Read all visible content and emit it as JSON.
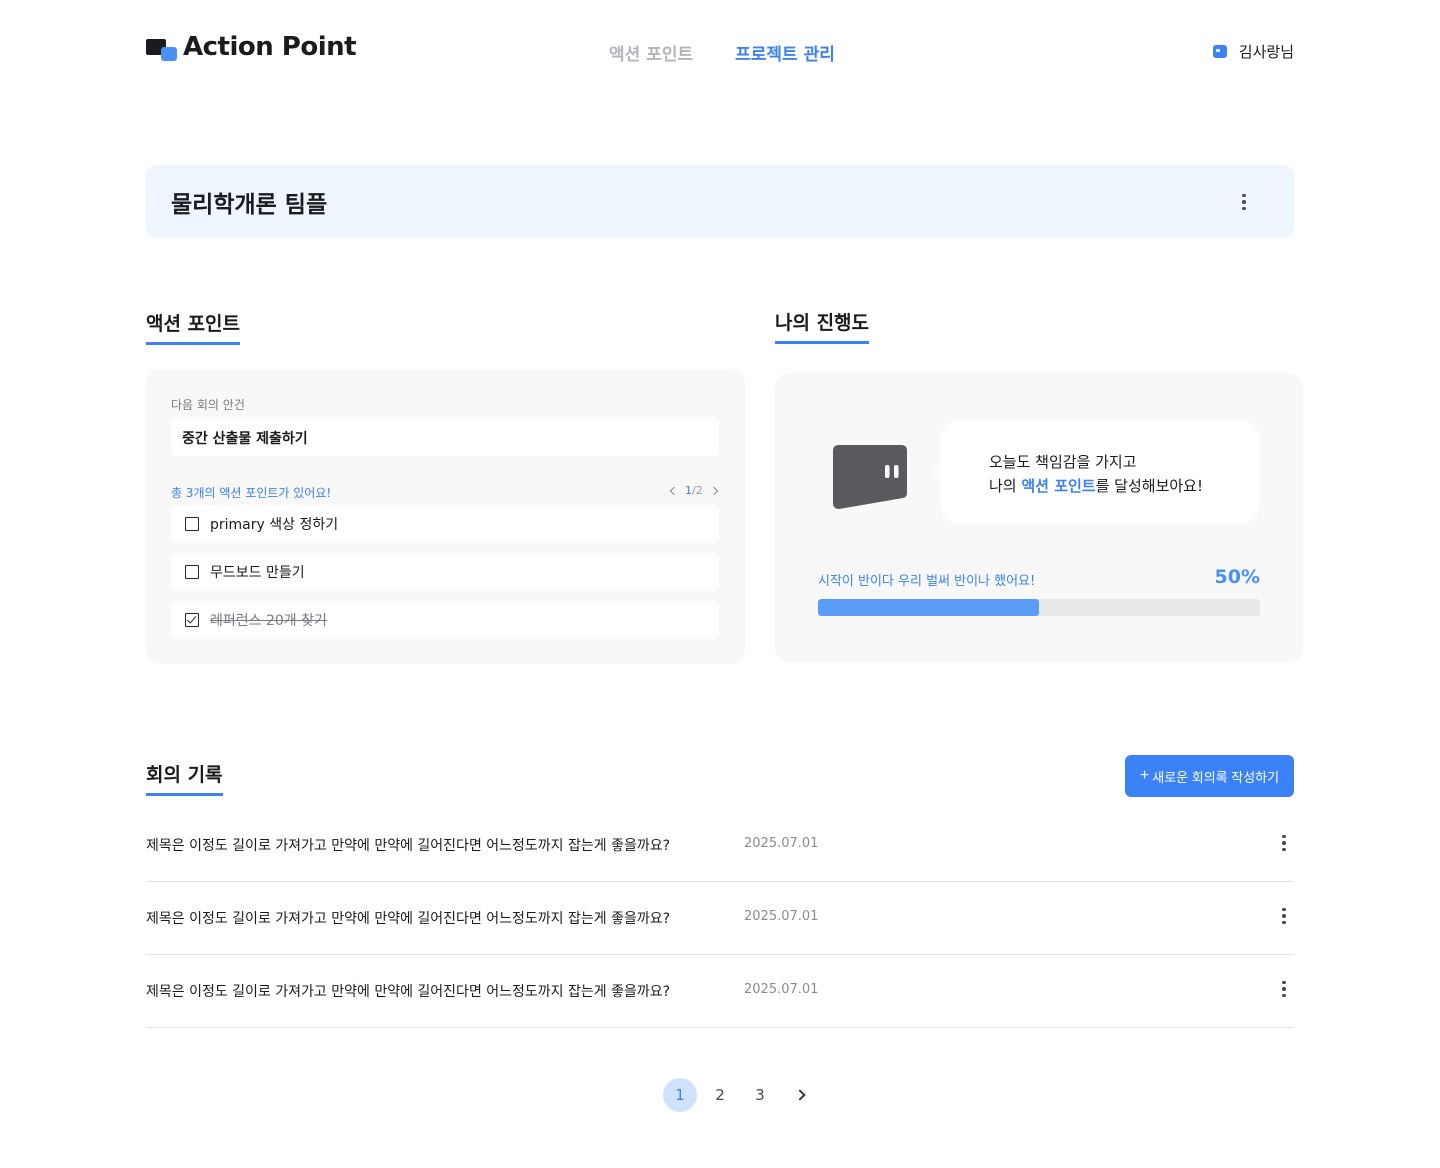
{
  "header": {
    "logo_text": "Action Point",
    "nav": [
      {
        "label": "액션 포인트",
        "active": false
      },
      {
        "label": "프로젝트 관리",
        "active": true
      }
    ],
    "user_name": "김사랑님"
  },
  "project": {
    "title": "물리학개론 팀플"
  },
  "action_points": {
    "section_title": "액션 포인트",
    "next_agenda_label": "다음 회의 안건",
    "next_agenda_value": "중간 산출물 제출하기",
    "count_text": "총 3개의 액션 포인트가 있어요!",
    "page_current": "1",
    "page_total": "/2",
    "items": [
      {
        "label": "primary 색상 정하기",
        "checked": false
      },
      {
        "label": "무드보드 만들기",
        "checked": false
      },
      {
        "label": "레퍼런스 20개 찾기",
        "checked": true
      }
    ]
  },
  "progress": {
    "section_title": "나의 진행도",
    "bubble_line1": "오늘도 책임감을 가지고",
    "bubble_line2_prefix": "나의 ",
    "bubble_line2_highlight": "액션 포인트",
    "bubble_line2_suffix": "를 달성해보아요!",
    "message": "시작이 반이다 우리 벌써 반이나 했어요!",
    "percent_text": "50%",
    "percent_value": 50,
    "accent_color": "#3b82f6"
  },
  "meetings": {
    "section_title": "회의 기록",
    "new_button_label": "새로운 회의록 작성하기",
    "new_button_icon": "+",
    "records": [
      {
        "title": "제목은 이정도 길이로 가져가고 만약에 만약에 길어진다면 어느정도까지 잡는게 좋을까요?",
        "date": "2025.07.01"
      },
      {
        "title": "제목은 이정도 길이로 가져가고 만약에 만약에 길어진다면 어느정도까지 잡는게 좋을까요?",
        "date": "2025.07.01"
      },
      {
        "title": "제목은 이정도 길이로 가져가고 만약에 만약에 길어진다면 어느정도까지 잡는게 좋을까요?",
        "date": "2025.07.01"
      }
    ]
  },
  "pagination": {
    "pages": [
      "1",
      "2",
      "3"
    ],
    "current": "1"
  }
}
